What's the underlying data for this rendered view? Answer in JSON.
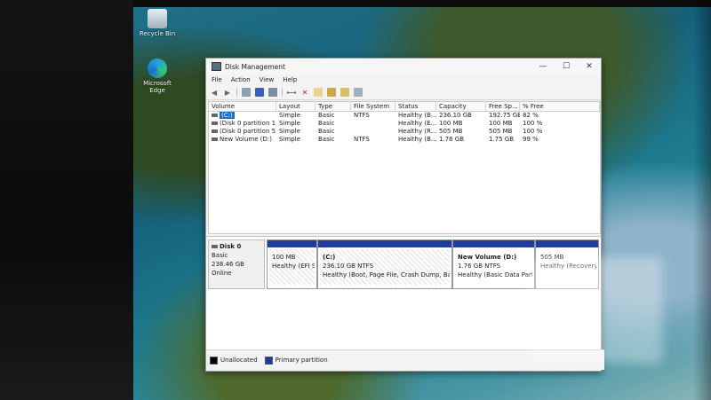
{
  "desktop": {
    "icons": [
      {
        "label": "Recycle Bin",
        "icon": "recycle-bin-icon"
      },
      {
        "label": "Microsoft Edge",
        "icon": "edge-icon"
      }
    ]
  },
  "window": {
    "title": "Disk Management",
    "controls": {
      "minimize": "—",
      "maximize": "☐",
      "close": "✕"
    },
    "menu": [
      "File",
      "Action",
      "View",
      "Help"
    ]
  },
  "volume_table": {
    "headers": [
      "Volume",
      "Layout",
      "Type",
      "File System",
      "Status",
      "Capacity",
      "Free Sp...",
      "% Free"
    ],
    "rows": [
      [
        "(C:)",
        "Simple",
        "Basic",
        "NTFS",
        "Healthy (B...",
        "236.10 GB",
        "192.75 GB",
        "82 %"
      ],
      [
        "(Disk 0 partition 1)",
        "Simple",
        "Basic",
        "",
        "Healthy (E...",
        "100 MB",
        "100 MB",
        "100 %"
      ],
      [
        "(Disk 0 partition 5)",
        "Simple",
        "Basic",
        "",
        "Healthy (R...",
        "505 MB",
        "505 MB",
        "100 %"
      ],
      [
        "New Volume (D:)",
        "Simple",
        "Basic",
        "NTFS",
        "Healthy (B...",
        "1.76 GB",
        "1.75 GB",
        "99 %"
      ]
    ]
  },
  "disk": {
    "name": "Disk 0",
    "type": "Basic",
    "size": "238.46 GB",
    "status": "Online",
    "partitions": [
      {
        "name": "",
        "size": "100 MB",
        "status": "Healthy (EFI Sy"
      },
      {
        "name": "(C:)",
        "size": "236.10 GB NTFS",
        "status": "Healthy (Boot, Page File, Crash Dump, Basic C"
      },
      {
        "name": "New Volume  (D:)",
        "size": "1.76 GB NTFS",
        "status": "Healthy (Basic Data Partitio"
      },
      {
        "name": "",
        "size": "505 MB",
        "status": "Healthy (Recovery"
      }
    ]
  },
  "legend": {
    "unallocated": "Unallocated",
    "primary": "Primary partition",
    "colors": {
      "unallocated": "#000000",
      "primary": "#1f3d9a"
    }
  }
}
